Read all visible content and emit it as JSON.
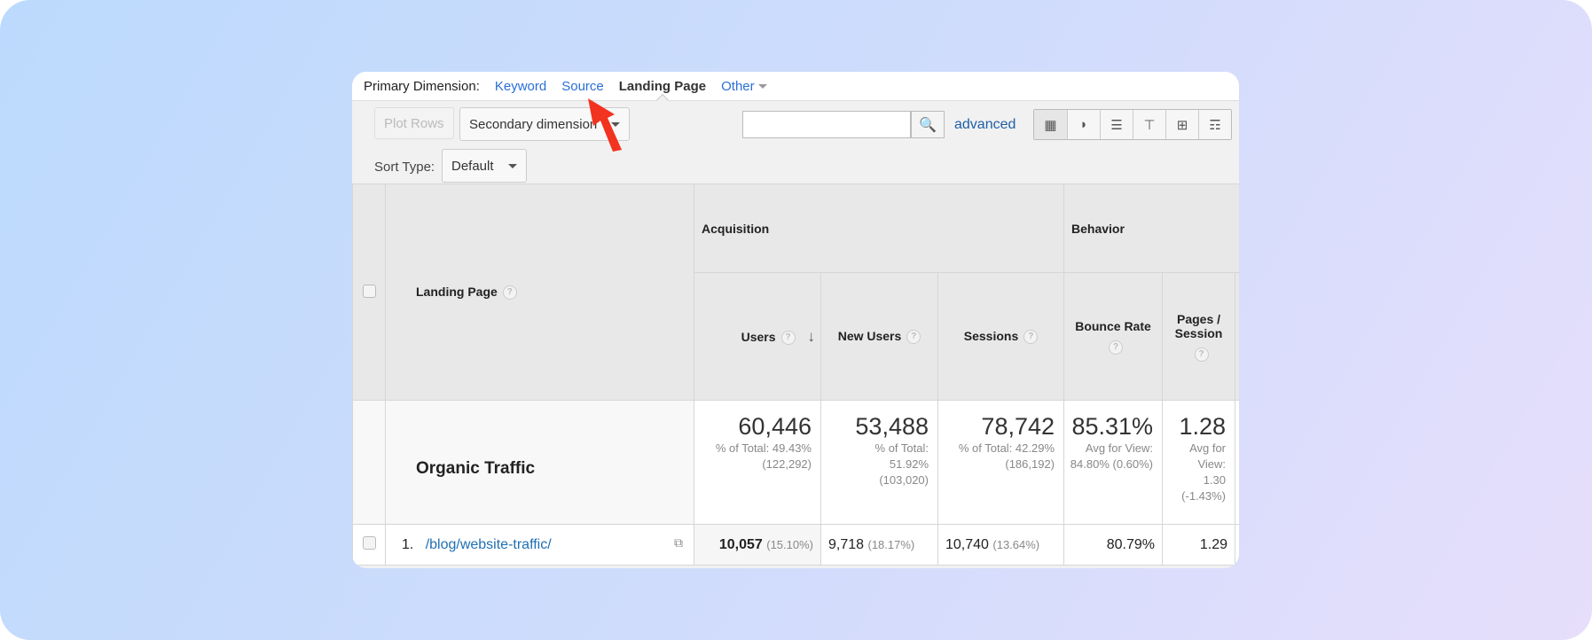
{
  "primary_dimension": {
    "label": "Primary Dimension:",
    "options": [
      "Keyword",
      "Source",
      "Landing Page",
      "Other"
    ],
    "selected": "Landing Page"
  },
  "toolbar": {
    "plot_rows": "Plot Rows",
    "secondary_dimension": "Secondary dimension",
    "search_value": "",
    "advanced": "advanced",
    "sort_type_label": "Sort Type:",
    "sort_type_value": "Default"
  },
  "table": {
    "dimension_header": "Landing Page",
    "groups": [
      "Acquisition",
      "Behavior"
    ],
    "columns": [
      "Users",
      "New Users",
      "Sessions",
      "Bounce Rate",
      "Pages / Session"
    ],
    "summary": {
      "label": "Organic Traffic",
      "cells": [
        {
          "value": "60,446",
          "sub": "% of Total: 49.43% (122,292)"
        },
        {
          "value": "53,488",
          "sub": "% of Total: 51.92% (103,020)"
        },
        {
          "value": "78,742",
          "sub": "% of Total: 42.29% (186,192)"
        },
        {
          "value": "85.31%",
          "sub": "Avg for View: 84.80% (0.60%)"
        },
        {
          "value": "1.28",
          "sub": "Avg for View: 1.30 (-1.43%)"
        }
      ]
    },
    "rows": [
      {
        "index": "1.",
        "page": "/blog/website-traffic/",
        "users": "10,057",
        "users_pct": "(15.10%)",
        "new_users": "9,718",
        "new_users_pct": "(18.17%)",
        "sessions": "10,740",
        "sessions_pct": "(13.64%)",
        "bounce_rate": "80.79%",
        "pages_session": "1.29"
      }
    ]
  },
  "colors": {
    "link": "#2a6fd6",
    "arrow": "#f2331f"
  }
}
